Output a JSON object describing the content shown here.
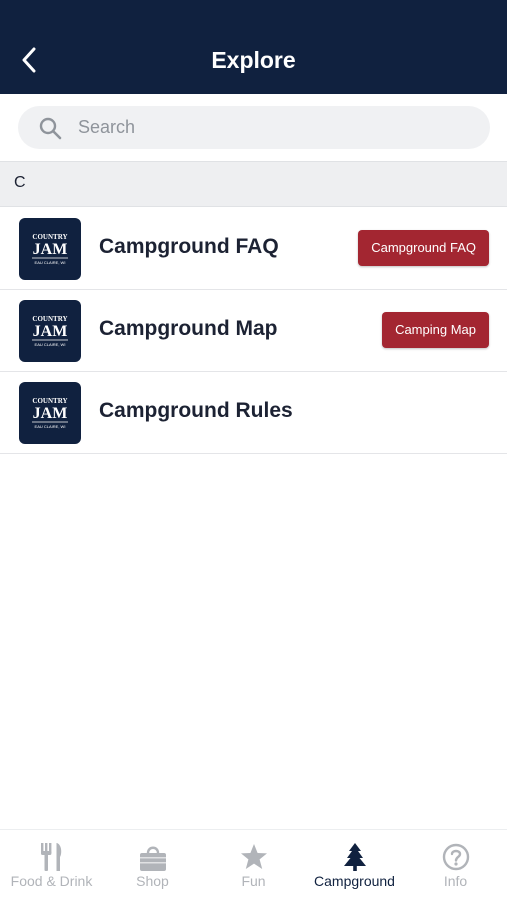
{
  "header": {
    "title": "Explore"
  },
  "search": {
    "placeholder": "Search"
  },
  "section": {
    "letter": "C"
  },
  "logo": {
    "line1": "COUNTRY",
    "line2": "JAM",
    "line3": "EAU CLAIRE, WI"
  },
  "items": [
    {
      "label": "Campground FAQ",
      "tag": "Campground FAQ"
    },
    {
      "label": "Campground Map",
      "tag": "Camping Map"
    },
    {
      "label": "Campground Rules",
      "tag": ""
    }
  ],
  "tabs": [
    {
      "label": "Food & Drink",
      "icon": "fork-knife-icon",
      "active": false
    },
    {
      "label": "Shop",
      "icon": "shopping-bag-icon",
      "active": false
    },
    {
      "label": "Fun",
      "icon": "star-icon",
      "active": false
    },
    {
      "label": "Campground",
      "icon": "pine-tree-icon",
      "active": true
    },
    {
      "label": "Info",
      "icon": "question-circle-icon",
      "active": false
    }
  ],
  "colors": {
    "header_bg": "#10213f",
    "tag_bg": "#a32631",
    "tab_inactive": "#b1b4b9",
    "tab_active": "#10213f"
  }
}
